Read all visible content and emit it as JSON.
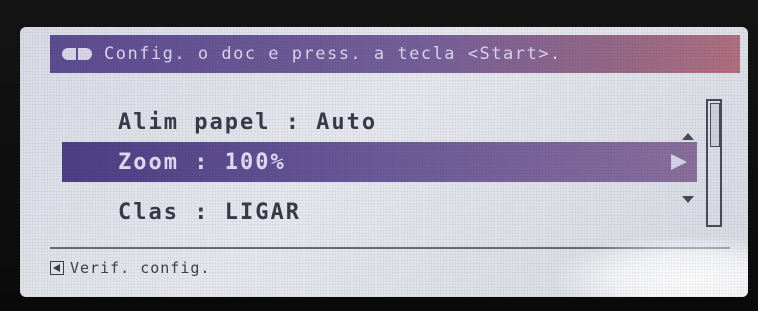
{
  "header": {
    "icon": "document-feed-icon",
    "text": "Config. o doc e press. a tecla <Start>."
  },
  "menu": {
    "items": [
      {
        "label": "Alim papel : Auto",
        "selected": false
      },
      {
        "label": "Zoom : 100%",
        "selected": true
      },
      {
        "label": "Clas : LIGAR",
        "selected": false
      }
    ]
  },
  "footer": {
    "icon": "back-icon",
    "label": "Verif. config."
  },
  "colors": {
    "header_bar": "#6a5a9a",
    "selection": "#5a4a8e",
    "screen_bg": "#dfe1e8"
  }
}
